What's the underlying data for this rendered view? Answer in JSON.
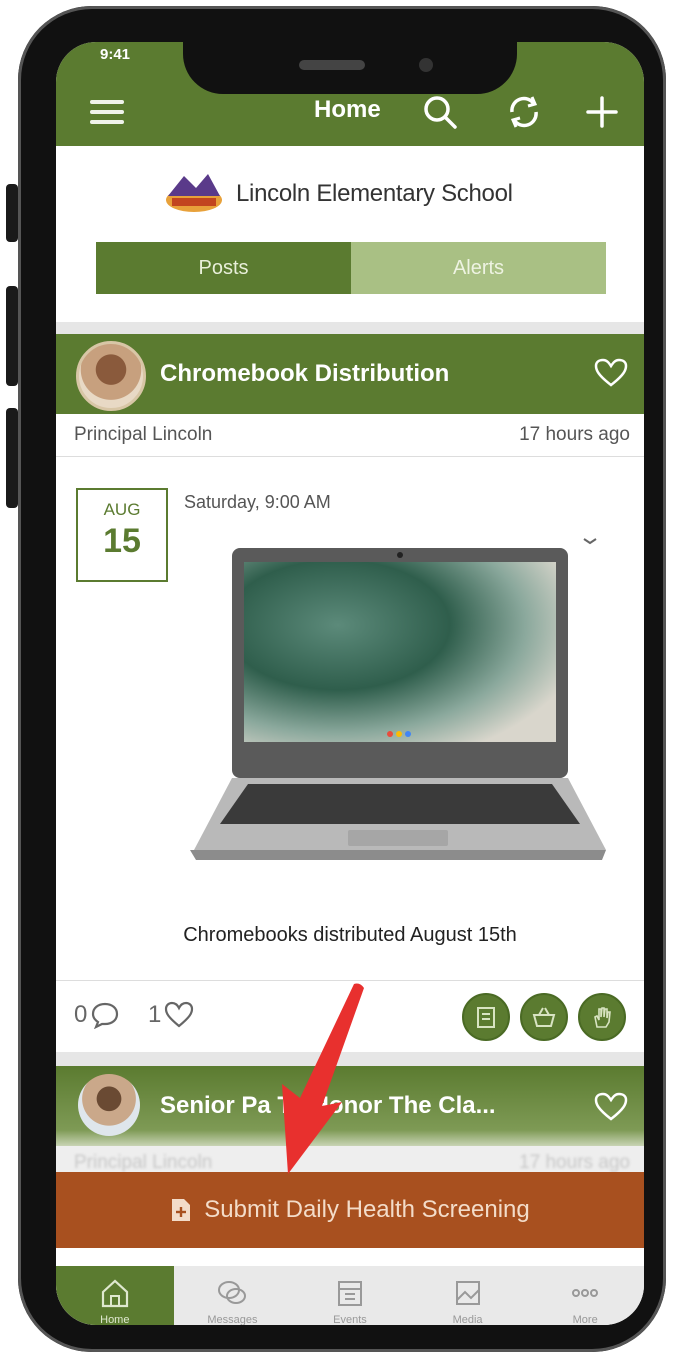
{
  "status_bar": {
    "time": "9:41"
  },
  "header": {
    "title": "Home"
  },
  "school": {
    "name": "Lincoln Elementary School"
  },
  "tabs": [
    {
      "label": "Posts",
      "active": true
    },
    {
      "label": "Alerts",
      "active": false
    }
  ],
  "post": {
    "title": "Chromebook Distribution",
    "author": "Principal Lincoln",
    "time_ago": "17 hours ago",
    "date_month": "AUG",
    "date_day": "15",
    "event_time": "Saturday, 9:00 AM",
    "caption": "Chromebooks distributed August 15th",
    "comments": "0",
    "likes": "1"
  },
  "post2": {
    "title": "Senior Pa      To Honor The Cla...",
    "author": "Principal Lincoln",
    "time_ago": "17 hours ago"
  },
  "health_button": {
    "label": "Submit Daily Health Screening"
  },
  "bottom_nav": [
    {
      "label": "Home",
      "icon": "home-icon"
    },
    {
      "label": "Messages",
      "icon": "chat-icon"
    },
    {
      "label": "Events",
      "icon": "calendar-icon"
    },
    {
      "label": "Media",
      "icon": "image-icon"
    },
    {
      "label": "More",
      "icon": "more-icon"
    }
  ],
  "colors": {
    "brand_green": "#5b7b30",
    "alert_tab": "#a9c084",
    "health_button": "#a8501f",
    "annotation_arrow": "#e8302e"
  }
}
